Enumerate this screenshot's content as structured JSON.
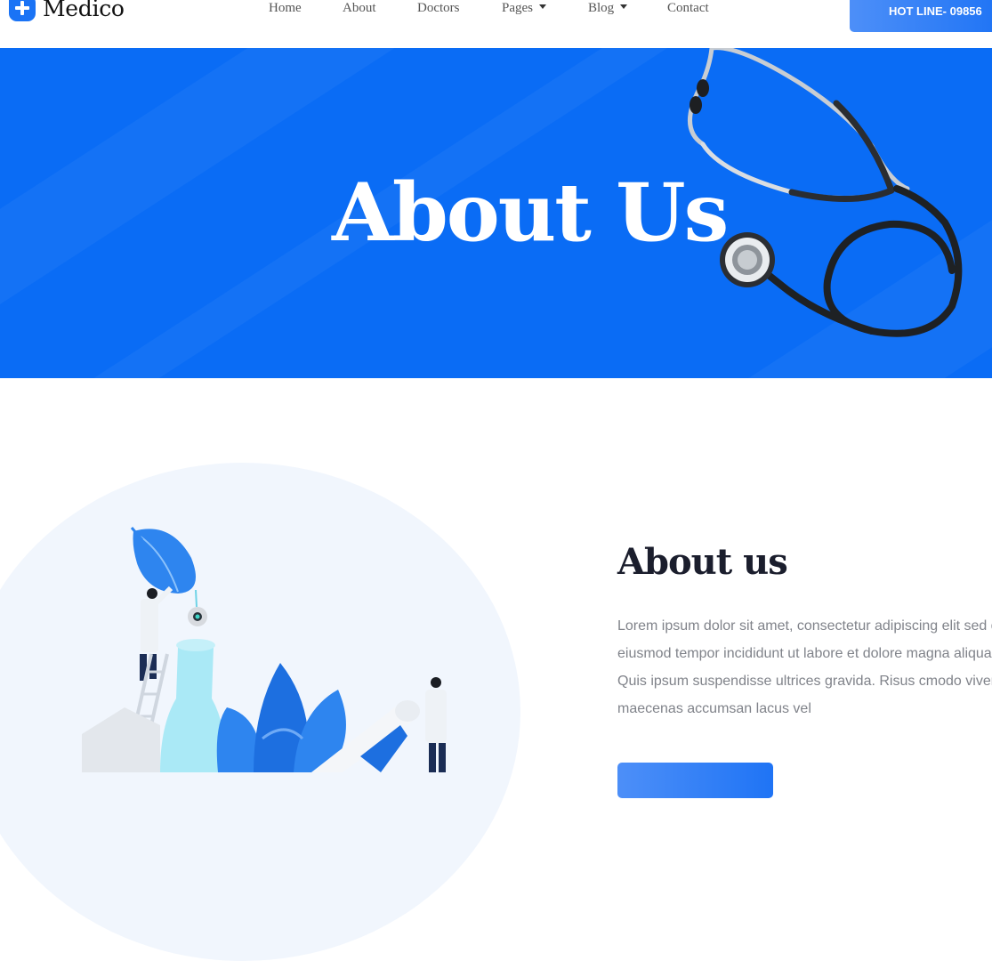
{
  "brand": {
    "name": "Medico",
    "icon": "plus-icon"
  },
  "nav": {
    "items": [
      {
        "label": "Home",
        "dropdown": false
      },
      {
        "label": "About",
        "dropdown": false
      },
      {
        "label": "Doctors",
        "dropdown": false
      },
      {
        "label": "Pages",
        "dropdown": true
      },
      {
        "label": "Blog",
        "dropdown": true
      },
      {
        "label": "Contact",
        "dropdown": false
      }
    ],
    "hotline_label": "HOT LINE- 09856"
  },
  "hero": {
    "title": "About Us",
    "image": "stethoscope"
  },
  "about": {
    "heading": "About us",
    "lines": [
      "Lorem ipsum dolor sit amet, consectetur adipiscing elit sed do",
      "eiusmod tempor incididunt ut labore et dolore magna aliqua.",
      "Quis ipsum suspendisse ultrices gravida. Risus cmodo viverra",
      "maecenas accumsan lacus vel"
    ],
    "illustration": "lab-scientists-flask-leaf"
  },
  "colors": {
    "primary": "#0a6cf5",
    "accent_gradient_start": "#4d8ff8",
    "heading": "#1b1e2d",
    "body_text": "#80838a",
    "blob": "#f1f6fd"
  }
}
